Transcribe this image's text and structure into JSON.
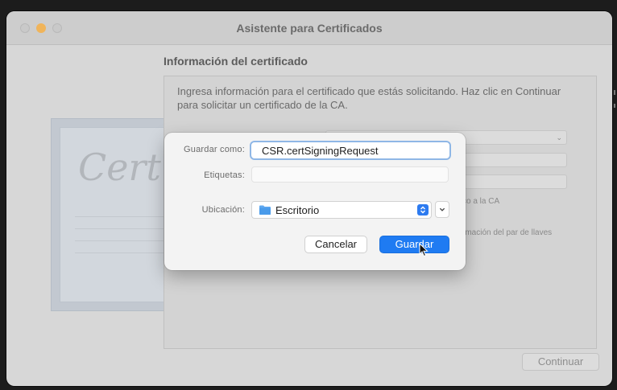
{
  "window": {
    "title": "Asistente para Certificados"
  },
  "background": {
    "watermark_text": "Cert",
    "section_title": "Información del certificado",
    "instructions": "Ingresa información para el certificado que estás solicitando. Haz clic en Continuar para solicitar un certificado de la CA.",
    "partial_option_ca": "co a la CA",
    "partial_option_keypair": "rmación del par de llaves",
    "continue_label": "Continuar"
  },
  "save_sheet": {
    "save_as_label": "Guardar como:",
    "save_as_value": "CSR.certSigningRequest",
    "tags_label": "Etiquetas:",
    "tags_value": "",
    "location_label": "Ubicación:",
    "location_value": "Escritorio",
    "cancel_label": "Cancelar",
    "save_label": "Guardar"
  },
  "icons": {
    "folder": "folder-icon",
    "stepper": "up-down-stepper-icon",
    "expand": "chevron-down-icon",
    "cursor": "mouse-pointer-icon"
  },
  "colors": {
    "accent": "#1f7bf2",
    "focus_ring": "#8fb7e6",
    "minimize_light": "#f0b45a"
  }
}
